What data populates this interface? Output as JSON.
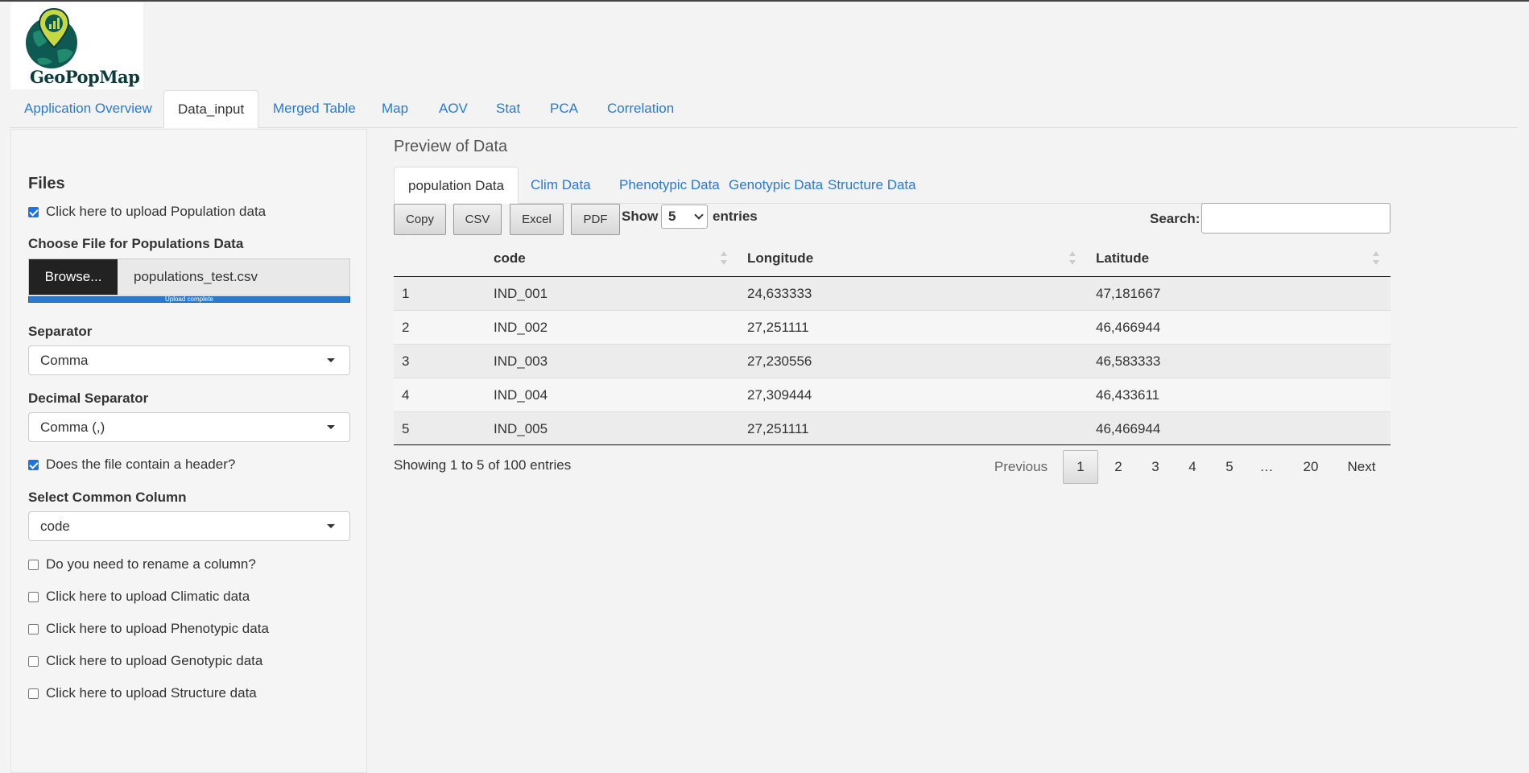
{
  "app": {
    "logo_text": "GeoPopMap",
    "logo_icon": "globe-pin-chart-icon"
  },
  "main_tabs": [
    {
      "label": "Application Overview",
      "active": false
    },
    {
      "label": "Data_input",
      "active": true
    },
    {
      "label": "Merged Table",
      "active": false
    },
    {
      "label": "Map",
      "active": false
    },
    {
      "label": "AOV",
      "active": false
    },
    {
      "label": "Stat",
      "active": false
    },
    {
      "label": "PCA",
      "active": false
    },
    {
      "label": "Correlation",
      "active": false
    }
  ],
  "sidebar": {
    "title": "Files",
    "upload_population": {
      "label": "Click here to upload Population data",
      "checked": true
    },
    "file_label": "Choose File for Populations Data",
    "browse_label": "Browse...",
    "file_name": "populations_test.csv",
    "upload_status": "Upload complete",
    "upload_progress": 1.0,
    "separator": {
      "label": "Separator",
      "value": "Comma"
    },
    "decimal": {
      "label": "Decimal Separator",
      "value": "Comma (,)"
    },
    "header_check": {
      "label": "Does the file contain a header?",
      "checked": true
    },
    "common_column": {
      "label": "Select Common Column",
      "value": "code"
    },
    "rename_check": {
      "label": "Do you need to rename a column?",
      "checked": false
    },
    "climatic_check": {
      "label": "Click here to upload Climatic data",
      "checked": false
    },
    "phenotypic_check": {
      "label": "Click here to upload Phenotypic data",
      "checked": false
    },
    "genotypic_check": {
      "label": "Click here to upload Genotypic data",
      "checked": false
    },
    "structure_check": {
      "label": "Click here to upload Structure data",
      "checked": false
    }
  },
  "preview": {
    "title": "Preview of Data",
    "tabs": [
      {
        "label": "population Data",
        "active": true
      },
      {
        "label": "Clim Data",
        "active": false
      },
      {
        "label": "Phenotypic Data",
        "active": false
      },
      {
        "label": "Genotypic Data",
        "active": false
      },
      {
        "label": "Structure Data",
        "active": false
      }
    ],
    "buttons": {
      "copy": "Copy",
      "csv": "CSV",
      "excel": "Excel",
      "pdf": "PDF"
    },
    "show_label": "Show",
    "entries_value": "5",
    "entries_label": "entries",
    "search_label": "Search:",
    "search_value": "",
    "columns": [
      "",
      "code",
      "Longitude",
      "Latitude"
    ],
    "rows": [
      [
        "1",
        "IND_001",
        "24,633333",
        "47,181667"
      ],
      [
        "2",
        "IND_002",
        "27,251111",
        "46,466944"
      ],
      [
        "3",
        "IND_003",
        "27,230556",
        "46,583333"
      ],
      [
        "4",
        "IND_004",
        "27,309444",
        "46,433611"
      ],
      [
        "5",
        "IND_005",
        "27,251111",
        "46,466944"
      ]
    ],
    "info": "Showing 1 to 5 of 100 entries",
    "pagination": {
      "previous": "Previous",
      "pages": [
        "1",
        "2",
        "3",
        "4",
        "5",
        "…",
        "20"
      ],
      "current": "1",
      "next": "Next"
    }
  },
  "colors": {
    "link": "#2a7ad0",
    "browse_bg": "#222222",
    "progress": "#2a7ad0"
  }
}
